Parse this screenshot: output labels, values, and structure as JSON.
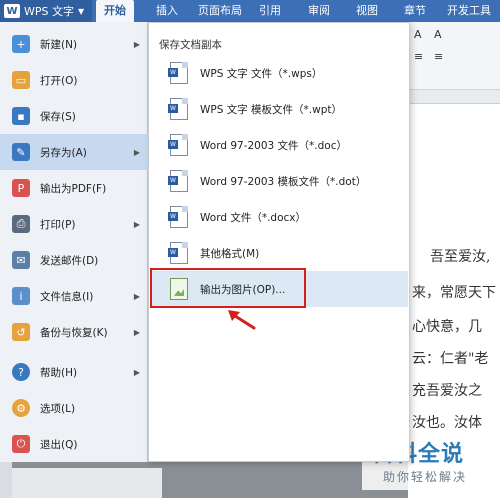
{
  "app": {
    "title": "WPS 文字",
    "logo_text": "W"
  },
  "ribbon_tabs": [
    "开始",
    "插入",
    "页面布局",
    "引用",
    "审阅",
    "视图",
    "章节",
    "开发工具"
  ],
  "menu": {
    "items": [
      {
        "label": "新建(N)",
        "icon": "new-doc-icon",
        "color": "#4a90d9",
        "arrow": true
      },
      {
        "label": "打开(O)",
        "icon": "folder-open-icon",
        "color": "#e6a23c",
        "arrow": false
      },
      {
        "label": "保存(S)",
        "icon": "save-icon",
        "color": "#3a78c2",
        "arrow": false
      },
      {
        "label": "另存为(A)",
        "icon": "save-as-icon",
        "color": "#3a78c2",
        "arrow": true
      },
      {
        "label": "输出为PDF(F)",
        "icon": "pdf-icon",
        "color": "#d9534f",
        "arrow": false
      },
      {
        "label": "打印(P)",
        "icon": "print-icon",
        "color": "#5a6b7d",
        "arrow": true
      },
      {
        "label": "发送邮件(D)",
        "icon": "mail-icon",
        "color": "#5b7fa6",
        "arrow": false
      },
      {
        "label": "文件信息(I)",
        "icon": "file-info-icon",
        "color": "#5b8fc9",
        "arrow": true
      },
      {
        "label": "备份与恢复(K)",
        "icon": "backup-icon",
        "color": "#e6a23c",
        "arrow": true
      },
      {
        "label": "帮助(H)",
        "icon": "help-icon",
        "color": "#3a78c2",
        "arrow": true
      },
      {
        "label": "选项(L)",
        "icon": "gear-icon",
        "color": "#e6a23c",
        "arrow": false
      },
      {
        "label": "退出(Q)",
        "icon": "exit-icon",
        "color": "#d9534f",
        "arrow": false
      }
    ]
  },
  "submenu": {
    "heading": "保存文档副本",
    "items": [
      {
        "label": "WPS 文字 文件（*.wps）",
        "badge": "W"
      },
      {
        "label": "WPS 文字 模板文件（*.wpt）",
        "badge": "W"
      },
      {
        "label": "Word 97-2003 文件（*.doc）",
        "badge": "W"
      },
      {
        "label": "Word 97-2003 模板文件（*.dot）",
        "badge": "W"
      },
      {
        "label": "Word 文件（*.docx）",
        "badge": "W"
      },
      {
        "label": "其他格式(M)",
        "badge": "W"
      },
      {
        "label": "输出为图片(OP)...",
        "badge": ""
      }
    ]
  },
  "document": {
    "lines": [
      "吾至爱汝,",
      "来，常愿天下",
      "心快意，几",
      "云：仁者\"老",
      "充吾爱汝之",
      "汝也。汝体"
    ]
  },
  "toolbar_glyphs": [
    "A",
    "A",
    "≡",
    "≡"
  ],
  "watermark": {
    "title": "百科全说",
    "subtitle": "助你轻松解决"
  },
  "colors": {
    "ribbon": "#3c6fb5",
    "highlight_border": "#d41f1f",
    "active_menu": "#c7d9ee"
  }
}
